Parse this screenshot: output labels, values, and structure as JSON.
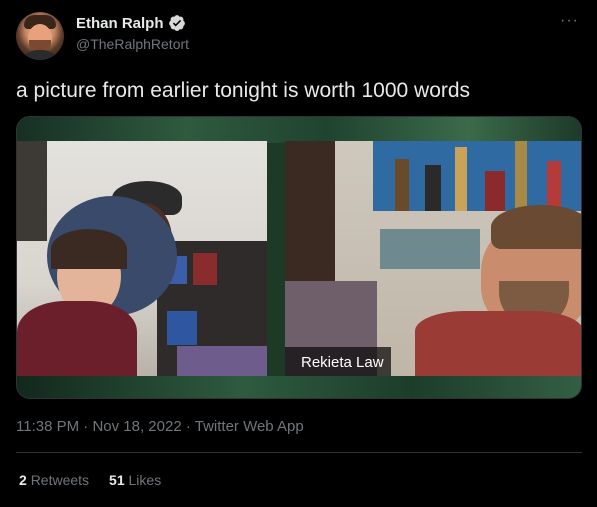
{
  "author": {
    "display_name": "Ethan Ralph",
    "handle": "@TheRalphRetort",
    "verified_icon": "verified-badge-icon",
    "avatar_icon": "avatar"
  },
  "menu": {
    "icon": "more-icon",
    "label": "···"
  },
  "tweet": {
    "text": "a picture from earlier tonight is worth 1000 words"
  },
  "media": {
    "name_tag": "Rekieta Law"
  },
  "meta": {
    "time": "11:38 PM",
    "separator1": " · ",
    "date": "Nov 18, 2022",
    "separator2": " · ",
    "source": "Twitter Web App"
  },
  "stats": {
    "retweets_count": "2",
    "retweets_label": "Retweets",
    "likes_count": "51",
    "likes_label": "Likes"
  },
  "colors": {
    "background": "#000000",
    "text_primary": "#e7e9ea",
    "text_secondary": "#71767b",
    "verified": "#d9d9d9",
    "divider": "#2f3336"
  }
}
